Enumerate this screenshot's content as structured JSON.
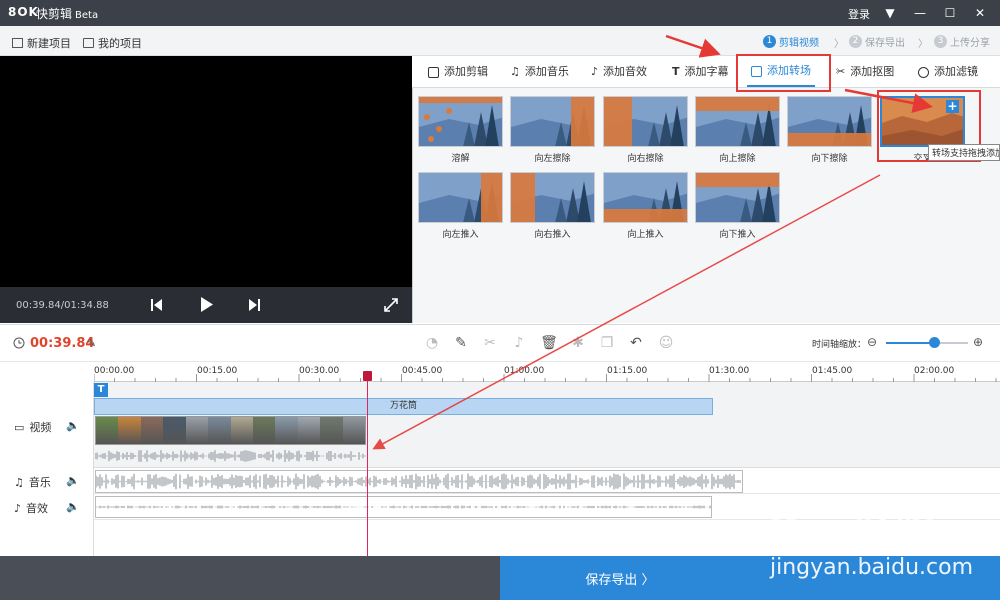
{
  "titlebar": {
    "logo": "8OK",
    "app_name": "快剪辑",
    "beta": "Beta",
    "login": "登录",
    "menu_icon": "dropdown-icon",
    "minimize_icon": "minimize-icon",
    "maximize_icon": "maximize-icon",
    "close_icon": "close-icon"
  },
  "toolbar": {
    "new_project": "新建项目",
    "my_projects": "我的项目",
    "steps": [
      {
        "num": "1",
        "label": "剪辑视频",
        "active": true
      },
      {
        "num": "2",
        "label": "保存导出",
        "active": false
      },
      {
        "num": "3",
        "label": "上传分享",
        "active": false
      }
    ]
  },
  "preview": {
    "timecode": "00:39.84/01:34.88"
  },
  "tabs": [
    {
      "label": "添加剪辑",
      "icon": "video-clip-icon"
    },
    {
      "label": "添加音乐",
      "icon": "music-note-icon"
    },
    {
      "label": "添加音效",
      "icon": "sound-effect-icon"
    },
    {
      "label": "添加字幕",
      "icon": "text-icon"
    },
    {
      "label": "添加转场",
      "icon": "transition-icon",
      "active": true
    },
    {
      "label": "添加抠图",
      "icon": "cutout-icon"
    },
    {
      "label": "添加滤镜",
      "icon": "filter-icon"
    }
  ],
  "transitions": {
    "row1": [
      "溶解",
      "向左擦除",
      "向右擦除",
      "向上擦除",
      "向下擦除",
      "交叉"
    ],
    "row2": [
      "向左推入",
      "向右推入",
      "向上推入",
      "向下推入"
    ],
    "tooltip": "转场支持拖拽添加",
    "add_label": "+"
  },
  "timeline": {
    "current_time": "00:39.84",
    "zoom_label": "时间轴缩放：",
    "ruler": [
      "00:00.00",
      "00:15.00",
      "00:30.00",
      "00:45.00",
      "01:00.00",
      "01:15.00",
      "01:30.00",
      "01:45.00",
      "02:00.00"
    ],
    "text_badge": "T",
    "text_clip": "万花筒",
    "tracks": {
      "video": "视频",
      "music": "音乐",
      "sfx": "音效"
    },
    "zoom_level": 0.58
  },
  "bottom": {
    "export": "保存导出 〉"
  },
  "watermark": {
    "main": "Bai 经验",
    "url": "jingyan.baidu.com"
  }
}
